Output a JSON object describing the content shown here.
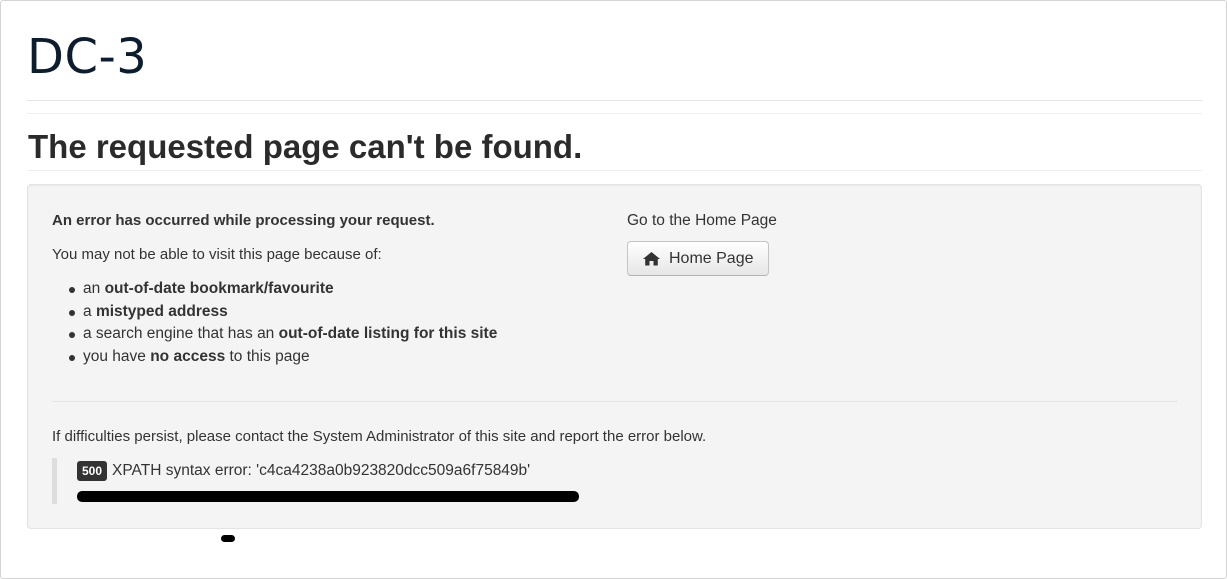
{
  "site": {
    "title": "DC-3"
  },
  "page": {
    "heading": "The requested page can't be found."
  },
  "error_panel": {
    "lead": "An error has occurred while processing your request.",
    "reason_intro": "You may not be able to visit this page because of:",
    "reasons": [
      {
        "prefix": "an ",
        "strong": "out-of-date bookmark/favourite",
        "suffix": ""
      },
      {
        "prefix": "a ",
        "strong": "mistyped address",
        "suffix": ""
      },
      {
        "prefix": "a search engine that has an ",
        "strong": "out-of-date listing for this site",
        "suffix": ""
      },
      {
        "prefix": "you have ",
        "strong": "no access",
        "suffix": " to this page"
      }
    ],
    "home_label": "Go to the Home Page",
    "home_button": "Home Page",
    "home_icon": "home-icon",
    "persist_text": "If difficulties persist, please contact the System Administrator of this site and report the error below.",
    "error_code": "500",
    "error_message": "XPATH syntax error: 'c4ca4238a0b923820dcc509a6f75849b'"
  },
  "colors": {
    "title": "#0b1d2e",
    "heading": "#2b2b2b",
    "well_background": "#f4f4f4",
    "badge_background": "#333333"
  }
}
